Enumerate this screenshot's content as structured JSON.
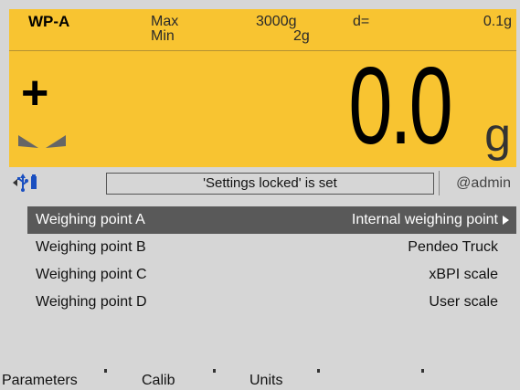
{
  "header": {
    "weighing_point": "WP-A",
    "max_label": "Max",
    "min_label": "Min",
    "max_value": "3000g",
    "min_value": "2g",
    "d_label": "d=",
    "d_value": "0.1g"
  },
  "display": {
    "sign": "+",
    "weight": "0.0",
    "unit": "g"
  },
  "status": {
    "message": "'Settings locked' is set",
    "user": "@admin"
  },
  "list": [
    {
      "label": "Weighing point A",
      "value": "Internal weighing point",
      "selected": true
    },
    {
      "label": "Weighing point B",
      "value": "Pendeo Truck",
      "selected": false
    },
    {
      "label": "Weighing point C",
      "value": "xBPI scale",
      "selected": false
    },
    {
      "label": "Weighing point D",
      "value": "User scale",
      "selected": false
    }
  ],
  "softkeys": [
    "Parameters",
    "Calib",
    "Units",
    "",
    ""
  ],
  "colors": {
    "display_bg": "#f8c431",
    "panel_bg": "#d6d6d6",
    "selected_row": "#595959"
  }
}
